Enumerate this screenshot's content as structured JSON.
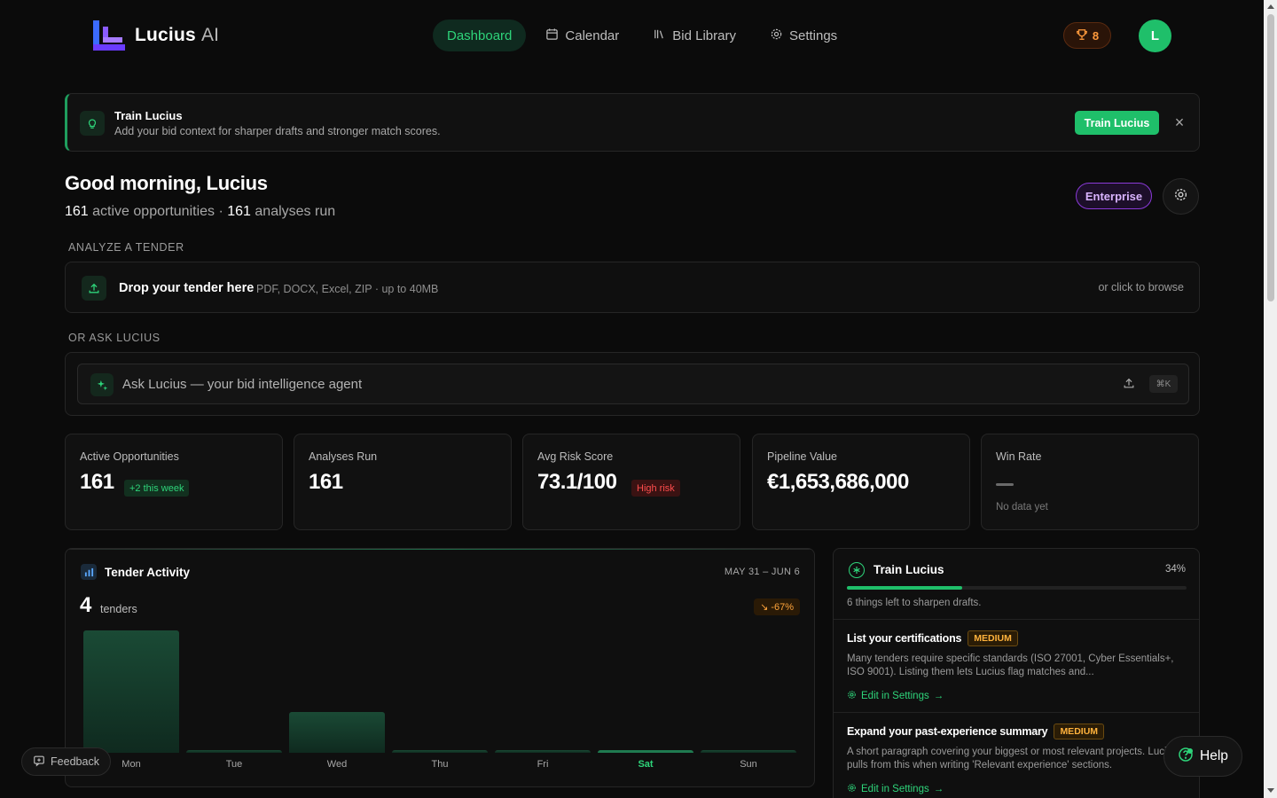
{
  "brand": {
    "name": "Lucius",
    "suffix": "AI"
  },
  "nav": {
    "items": [
      {
        "label": "Dashboard",
        "icon": "none"
      },
      {
        "label": "Calendar",
        "icon": "calendar-icon"
      },
      {
        "label": "Bid Library",
        "icon": "library-icon"
      },
      {
        "label": "Settings",
        "icon": "gear-icon"
      }
    ],
    "active": "Dashboard"
  },
  "header": {
    "trophy_count": "8",
    "avatar_initial": "L"
  },
  "banner": {
    "title": "Train Lucius",
    "subtitle": "Add your bid context for sharper drafts and stronger match scores.",
    "button": "Train Lucius",
    "close": "×"
  },
  "greeting": {
    "title": "Good morning, Lucius",
    "active_count": "161",
    "active_label": "active opportunities",
    "separator": "·",
    "analyses_count": "161",
    "analyses_label": "analyses run",
    "plan_badge": "Enterprise"
  },
  "analyze": {
    "section_label": "ANALYZE A TENDER",
    "title": "Drop your tender here",
    "formats": "PDF, DOCX, Excel, ZIP · up to 40MB",
    "browse": "or click to browse"
  },
  "ask": {
    "section_label": "OR ASK LUCIUS",
    "placeholder": "Ask Lucius — your bid intelligence agent",
    "shortcut": "⌘K"
  },
  "stats": [
    {
      "label": "Active Opportunities",
      "value": "161",
      "chip": "+2 this week",
      "chip_type": "green"
    },
    {
      "label": "Analyses Run",
      "value": "161",
      "chip": "",
      "chip_type": ""
    },
    {
      "label": "Avg Risk Score",
      "value": "73.1/100",
      "chip": "High risk",
      "chip_type": "red"
    },
    {
      "label": "Pipeline Value",
      "value": "€1,653,686,000",
      "chip": "",
      "chip_type": ""
    },
    {
      "label": "Win Rate",
      "value": "",
      "chip": "",
      "chip_type": "",
      "note": "No data yet"
    }
  ],
  "activity": {
    "title": "Tender Activity",
    "range": "MAY 31 – JUN 6",
    "count": "4",
    "unit": "tenders",
    "delta": "-67%",
    "today": "Sat"
  },
  "chart_data": {
    "type": "bar",
    "categories": [
      "Mon",
      "Tue",
      "Wed",
      "Thu",
      "Fri",
      "Sat",
      "Sun"
    ],
    "values": [
      3,
      0,
      1,
      0,
      0,
      0,
      0
    ],
    "ylim": [
      0,
      3
    ],
    "grid": false
  },
  "train": {
    "title": "Train Lucius",
    "percent": "34%",
    "progress": 0.34,
    "left_text": "6 things left to sharpen drafts.",
    "tasks": [
      {
        "title": "List your certifications",
        "priority": "MEDIUM",
        "description": "Many tenders require specific standards (ISO 27001, Cyber Essentials+, ISO 9001). Listing them lets Lucius flag matches and...",
        "link": "Edit in Settings"
      },
      {
        "title": "Expand your past-experience summary",
        "priority": "MEDIUM",
        "description": "A short paragraph covering your biggest or most relevant projects. Lucius pulls from this when writing 'Relevant experience' sections.",
        "link": "Edit in Settings"
      }
    ]
  },
  "floating": {
    "feedback": "Feedback",
    "help": "Help"
  },
  "colors": {
    "accent": "#1fbf6a",
    "background": "#0b0b0b",
    "enterprise": "#8a3ad8",
    "warning": "#ffa53c",
    "danger": "#ff4d4d"
  }
}
